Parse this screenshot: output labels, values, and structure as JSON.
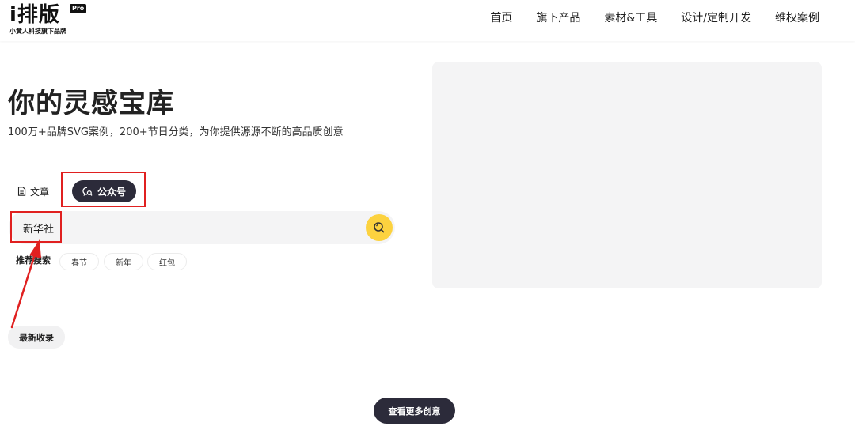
{
  "brand": {
    "logo_text": "i排版",
    "badge": "Pro",
    "subtitle": "小黄人科技旗下品牌"
  },
  "nav": {
    "items": [
      {
        "label": "首页"
      },
      {
        "label": "旗下产品"
      },
      {
        "label": "素材&工具"
      },
      {
        "label": "设计/定制开发"
      },
      {
        "label": "维权案例"
      }
    ]
  },
  "hero": {
    "title": "你的灵感宝库",
    "subtitle": "100万+品牌SVG案例，200+节日分类，为你提供源源不断的高品质创意"
  },
  "tabs": {
    "article": {
      "label": "文章",
      "icon": "document-icon"
    },
    "wechat": {
      "label": "公众号",
      "icon": "wechat-search-icon",
      "active": true
    }
  },
  "search": {
    "value": "新华社",
    "button_icon": "search-icon"
  },
  "recommended": {
    "label": "推荐搜索",
    "chips": [
      {
        "label": "春节"
      },
      {
        "label": "新年"
      },
      {
        "label": "红包"
      }
    ]
  },
  "latest": {
    "label": "最新收录"
  },
  "more": {
    "label": "查看更多创意"
  },
  "colors": {
    "dark_button": "#2c2b3a",
    "search_button": "#fcd23f",
    "annotation_red": "#e02020"
  }
}
